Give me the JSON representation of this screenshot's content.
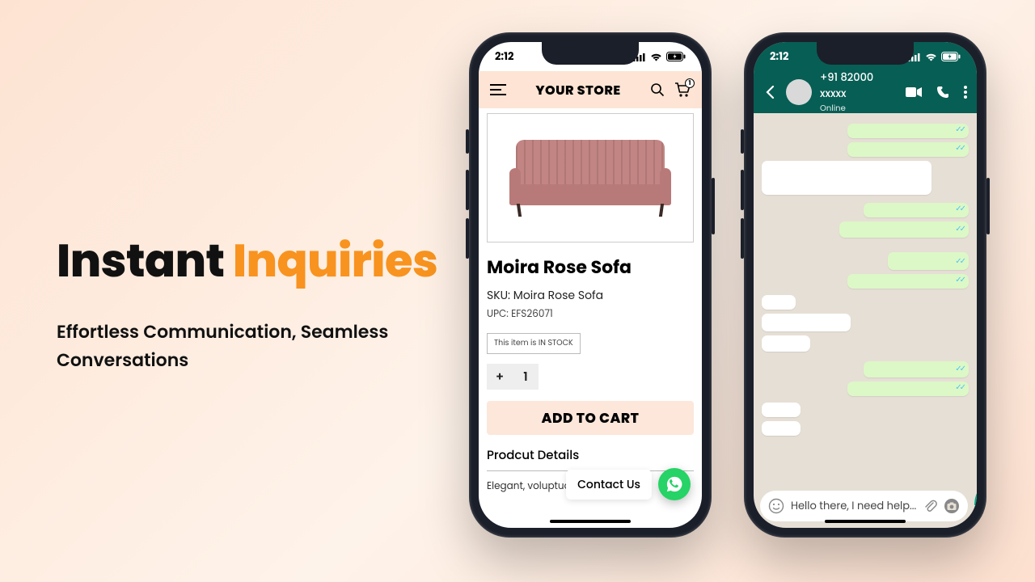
{
  "hero": {
    "title_a": "Instant ",
    "title_b": "Inquiries",
    "subtitle": "Effortless Communication, Seamless Conversations"
  },
  "status": {
    "time": "2:12"
  },
  "store": {
    "brand": "YOUR STORE",
    "cart_count": "1",
    "product_title": "Moira Rose Sofa",
    "sku_label": "SKU: Moira Rose Sofa",
    "upc_label": "UPC: EFS26071",
    "stock_label": "This item is IN STOCK",
    "qty_plus": "+",
    "qty_value": "1",
    "add_to_cart": "ADD TO CART",
    "details_title": "Prodcut Details",
    "description": "Elegant, voluptuous, decadent.....",
    "contact_label": "Contact Us"
  },
  "chat": {
    "number": "+91 82000 xxxxx",
    "status": "Online",
    "input_text": "Hello there, I need help..."
  }
}
